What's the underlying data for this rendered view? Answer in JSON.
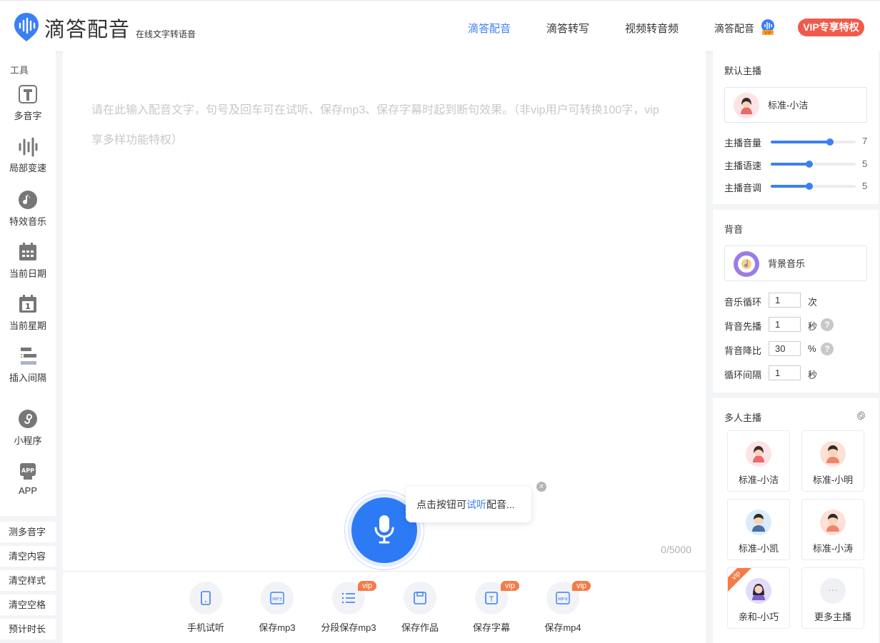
{
  "header": {
    "logo_title": "滴答配音",
    "logo_sub": "在线文字转语音",
    "nav": [
      "滴答配音",
      "滴答转写",
      "视频转音频",
      "滴答配音"
    ],
    "vip_button": "VIP专享特权",
    "accent_color": "#3b7ff5",
    "vip_color": "#f05a4a"
  },
  "sidebar": {
    "title": "工具",
    "tools": [
      "多音字",
      "局部变速",
      "特效音乐",
      "当前日期",
      "当前星期",
      "插入间隔",
      "小程序",
      "APP"
    ],
    "calendar_day": "1",
    "app_icon_text": "APP",
    "buttons": [
      "测多音字",
      "清空内容",
      "清空样式",
      "清空空格",
      "预计时长"
    ]
  },
  "editor": {
    "placeholder": "请在此输入配音文字，句号及回车可在试听、保存mp3、保存字幕时起到断句效果。（非vip用户可转换100字，vip享多样功能特权）",
    "counter": "0/5000",
    "tip_before": "点击按钮可",
    "tip_highlight": "试听",
    "tip_after": "配音...",
    "close": "×"
  },
  "actions": {
    "items": [
      "手机试听",
      "保存mp3",
      "分段保存mp3",
      "保存作品",
      "保存字幕",
      "保存mp4"
    ],
    "vip_tag": "vip",
    "mp3_icon": "MP3",
    "mp4_icon": "MP4",
    "text_icon": "T"
  },
  "anchor_panel": {
    "title": "默认主播",
    "current": "标准-小洁",
    "sliders": [
      {
        "label": "主播音量",
        "value": "7",
        "fraction": 0.7
      },
      {
        "label": "主播语速",
        "value": "5",
        "fraction": 0.45
      },
      {
        "label": "主播音调",
        "value": "5",
        "fraction": 0.45
      }
    ]
  },
  "bgm_panel": {
    "title": "背音",
    "current": "背景音乐",
    "fields": [
      {
        "label": "音乐循环",
        "value": "1",
        "unit": "次",
        "help": false
      },
      {
        "label": "背音先播",
        "value": "1",
        "unit": "秒",
        "help": true
      },
      {
        "label": "背音降比",
        "value": "30",
        "unit": "%",
        "help": true
      },
      {
        "label": "循环间隔",
        "value": "1",
        "unit": "秒",
        "help": false
      }
    ],
    "help_mark": "?"
  },
  "multi_panel": {
    "title": "多人主播",
    "anchors": [
      "标准-小洁",
      "标准-小明",
      "标准-小凯",
      "标准-小涛",
      "亲和-小巧",
      "更多主播"
    ],
    "vip_corner": "vip",
    "more_icon": "···"
  }
}
